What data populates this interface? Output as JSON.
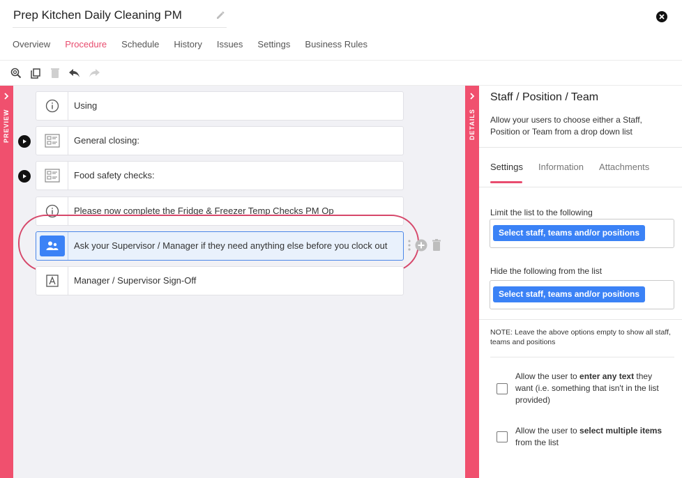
{
  "header": {
    "title": "Prep Kitchen Daily Cleaning PM"
  },
  "tabs": [
    {
      "label": "Overview",
      "active": false
    },
    {
      "label": "Procedure",
      "active": true
    },
    {
      "label": "Schedule",
      "active": false
    },
    {
      "label": "History",
      "active": false
    },
    {
      "label": "Issues",
      "active": false
    },
    {
      "label": "Settings",
      "active": false
    },
    {
      "label": "Business Rules",
      "active": false
    }
  ],
  "toolbar": {
    "icons": [
      "zoom-icon",
      "copy-icon",
      "delete-icon",
      "undo-icon",
      "redo-icon"
    ]
  },
  "side_bars": {
    "preview_label": "PREVIEW",
    "details_label": "DETAILS"
  },
  "steps": [
    {
      "label": "Using",
      "icon": "info-icon"
    },
    {
      "label": "General closing:",
      "icon": "checklist-icon",
      "has_play": true
    },
    {
      "label": "Food safety checks:",
      "icon": "checklist-icon",
      "has_play": true
    },
    {
      "label": "Please now complete the Fridge & Freezer Temp Checks PM Op",
      "icon": "info-icon"
    },
    {
      "label": "Ask your Supervisor / Manager if they need anything else before you clock out",
      "icon": "people-icon",
      "selected": true
    },
    {
      "label": "Manager / Supervisor Sign-Off",
      "icon": "text-field-icon"
    }
  ],
  "details": {
    "title": "Staff / Position / Team",
    "description": "Allow your users to choose either a Staff, Position or Team from a drop down list",
    "tabs": [
      {
        "label": "Settings",
        "active": true
      },
      {
        "label": "Information",
        "active": false
      },
      {
        "label": "Attachments",
        "active": false
      }
    ],
    "limit_label": "Limit the list to the following",
    "limit_chip": "Select staff, teams and/or positions",
    "hide_label": "Hide the following from the list",
    "hide_chip": "Select staff, teams and/or positions",
    "note": "NOTE: Leave the above options empty to show all staff, teams and positions",
    "option1": {
      "prefix": "Allow the user to ",
      "bold": "enter any text",
      "suffix": " they want (i.e. something that isn't in the list provided)",
      "checked": false
    },
    "option2": {
      "prefix": "Allow the user to ",
      "bold": "select multiple items",
      "suffix": " from the list",
      "checked": false
    }
  },
  "colors": {
    "accent": "#e84c6e",
    "sidebar": "#f0506e",
    "primary_blue": "#3b82f6",
    "canvas_bg": "#f1f1f5"
  }
}
